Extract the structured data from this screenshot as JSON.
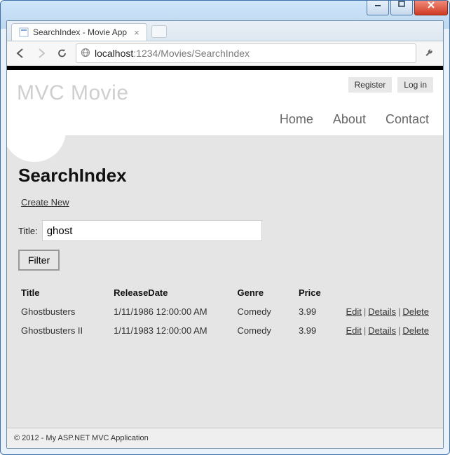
{
  "window": {
    "tab_title": "SearchIndex - Movie App",
    "address_host": "localhost",
    "address_port": ":1234",
    "address_rest": "/Movies/SearchIndex"
  },
  "header": {
    "brand": "MVC Movie",
    "register": "Register",
    "login": "Log in",
    "nav": {
      "home": "Home",
      "about": "About",
      "contact": "Contact"
    }
  },
  "page": {
    "title": "SearchIndex",
    "create_link": "Create New",
    "title_label": "Title:",
    "search_value": "ghost",
    "filter_label": "Filter"
  },
  "table": {
    "headers": {
      "title": "Title",
      "release": "ReleaseDate",
      "genre": "Genre",
      "price": "Price"
    },
    "actions": {
      "edit": "Edit",
      "details": "Details",
      "delete": "Delete"
    },
    "rows": [
      {
        "title": "Ghostbusters",
        "release": "1/11/1986 12:00:00 AM",
        "genre": "Comedy",
        "price": "3.99"
      },
      {
        "title": "Ghostbusters II",
        "release": "1/11/1983 12:00:00 AM",
        "genre": "Comedy",
        "price": "3.99"
      }
    ]
  },
  "footer": {
    "text": "© 2012 - My ASP.NET MVC Application"
  }
}
